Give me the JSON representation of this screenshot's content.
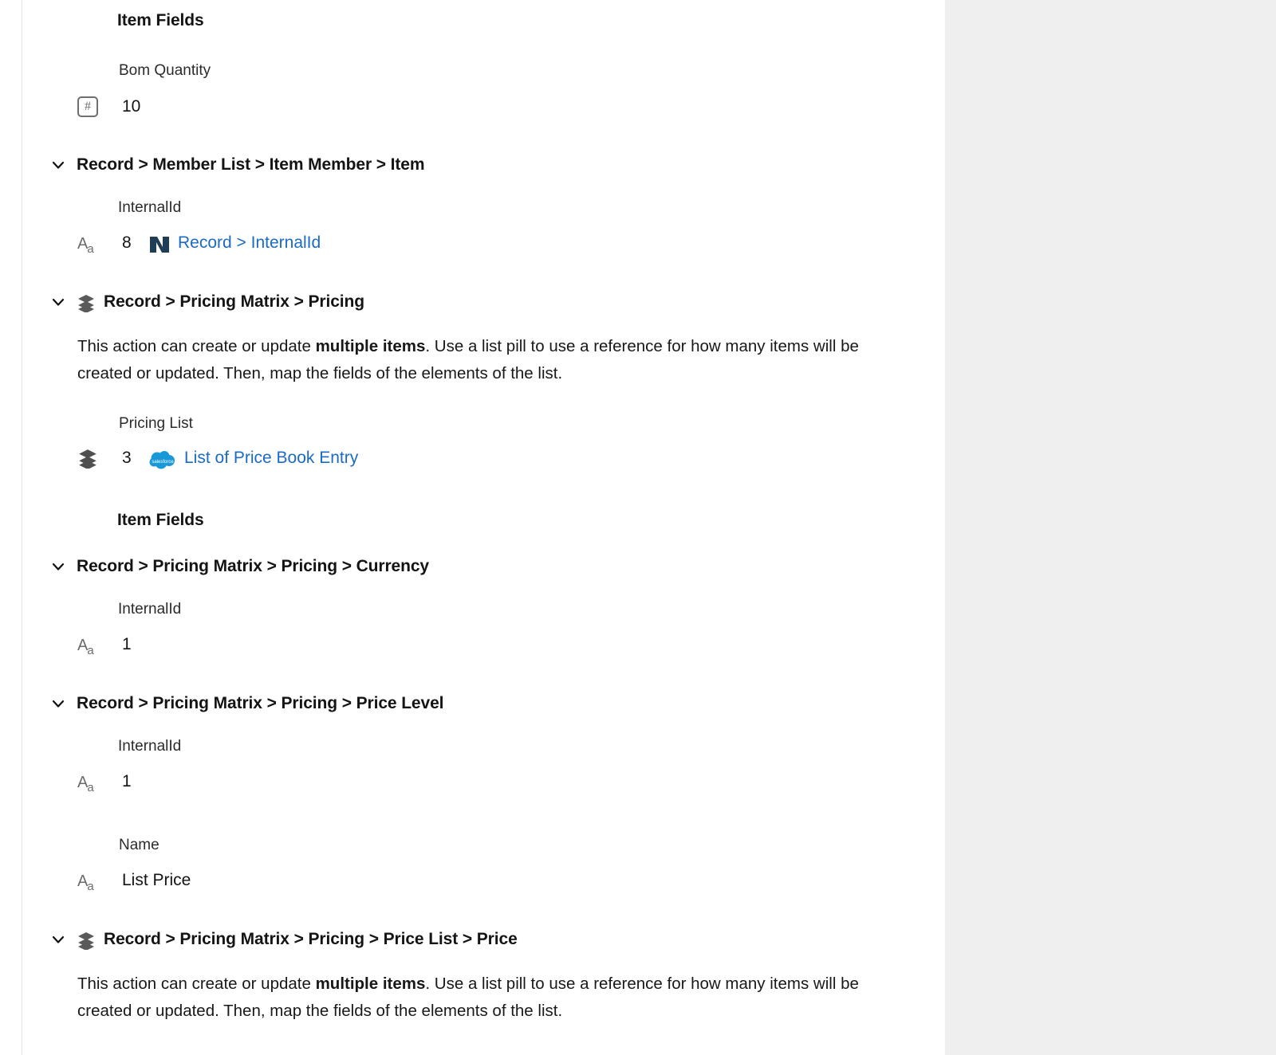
{
  "colors": {
    "link": "#1b6ac6",
    "salesforce_blue": "#00a1e0",
    "netsuite_navy": "#1f3d54",
    "netsuite_light": "#a9bdcc",
    "right_panel": "#efefef",
    "divider": "#e3e3e3"
  },
  "sections": {
    "item_fields_heading_1": "Item Fields",
    "item_fields_heading_2": "Item Fields",
    "bom_quantity": {
      "label": "Bom Quantity",
      "value": "10",
      "icon": "number-type-icon"
    },
    "member_list_item": {
      "title": "Record > Member List > Item Member > Item",
      "field_label": "InternalId",
      "count": "8",
      "pill_label": "Record > InternalId",
      "pill_icon": "netsuite-icon",
      "type_icon": "text-type-icon"
    },
    "pricing_matrix_pricing": {
      "title": "Record > Pricing Matrix > Pricing",
      "icon": "layers-icon",
      "description_part1": "This action can create or update ",
      "description_bold": "multiple items",
      "description_part2": ". Use a list pill to use a reference for how many items will be created or updated. Then, map the fields of the elements of the list.",
      "field_label": "Pricing List",
      "count": "3",
      "pill_label": "List of Price Book Entry",
      "pill_icon": "salesforce-icon",
      "type_icon": "layers-icon"
    },
    "pricing_currency": {
      "title": "Record > Pricing Matrix > Pricing > Currency",
      "field_label": "InternalId",
      "value": "1",
      "type_icon": "text-type-icon"
    },
    "pricing_price_level": {
      "title": "Record > Pricing Matrix > Pricing > Price Level",
      "field_label_1": "InternalId",
      "value_1": "1",
      "type_icon_1": "text-type-icon",
      "field_label_2": "Name",
      "value_2": "List Price",
      "type_icon_2": "text-type-icon"
    },
    "pricing_price_list_price": {
      "title": "Record > Pricing Matrix > Pricing > Price List > Price",
      "icon": "layers-icon",
      "description_part1": "This action can create or update ",
      "description_bold": "multiple items",
      "description_part2": ". Use a list pill to use a reference for how many items will be created or updated. Then, map the fields of the elements of the list."
    }
  }
}
